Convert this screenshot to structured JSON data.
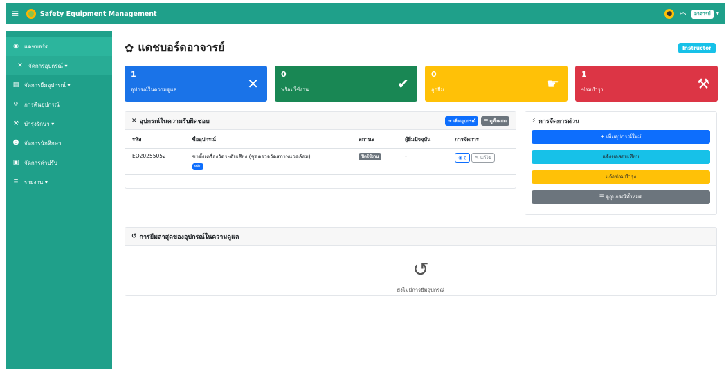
{
  "topbar": {
    "brand": "Safety Equipment Management",
    "user": "test",
    "role": "อาจารย์"
  },
  "sidebar": {
    "items": [
      {
        "label": "แดชบอร์ด",
        "icon": "palette-icon"
      },
      {
        "label": "จัดการอุปกรณ์ ▾",
        "icon": "tools-icon"
      },
      {
        "label": "จัดการยืมอุปกรณ์ ▾",
        "icon": "clipboard-icon"
      },
      {
        "label": "การคืนอุปกรณ์",
        "icon": "undo-icon"
      },
      {
        "label": "บำรุงรักษา ▾",
        "icon": "wrench-icon"
      },
      {
        "label": "จัดการนักศึกษา",
        "icon": "users-icon"
      },
      {
        "label": "จัดการค่าปรับ",
        "icon": "money-icon"
      },
      {
        "label": "รายงาน ▾",
        "icon": "list-icon"
      }
    ]
  },
  "page": {
    "title": "แดชบอร์ดอาจารย์",
    "badge": "Instructor"
  },
  "stats": [
    {
      "value": "1",
      "label": "อุปกรณ์ในความดูแล",
      "color": "#1a73e8",
      "icon": "tools-icon"
    },
    {
      "value": "0",
      "label": "พร้อมใช้งาน",
      "color": "#198754",
      "icon": "check-circle-icon"
    },
    {
      "value": "0",
      "label": "ถูกยืม",
      "color": "#ffc107",
      "icon": "hand-icon"
    },
    {
      "value": "1",
      "label": "ซ่อมบำรุง",
      "color": "#dc3545",
      "icon": "wrench-icon"
    }
  ],
  "equipment": {
    "title": "อุปกรณ์ในความรับผิดชอบ",
    "add_label": "+ เพิ่มอุปกรณ์",
    "view_all_label": "☰ ดูทั้งหมด",
    "columns": [
      "รหัส",
      "ชื่ออุปกรณ์",
      "สถานะ",
      "ผู้ยืมปัจจุบัน",
      "การจัดการ"
    ],
    "rows": [
      {
        "code": "EQ20255052",
        "name": "ขาตั้งเครื่องวัดระดับเสียง (ชุดตรวจวัดสภาพแวดล้อม)",
        "tag": "หลัก",
        "status": "ปิดใช้งาน",
        "borrower": "-",
        "view": "ดู",
        "edit": "แก้ไข"
      }
    ]
  },
  "quick": {
    "title": "การจัดการด่วน",
    "buttons": [
      {
        "label": "+ เพิ่มอุปกรณ์ใหม่",
        "bg": "#0d6efd",
        "fg": "#ffffff"
      },
      {
        "label": "แจ้งขอสอบเทียบ",
        "bg": "#17c1e8",
        "fg": "#212529"
      },
      {
        "label": "แจ้งซ่อมบำรุง",
        "bg": "#ffc107",
        "fg": "#212529"
      },
      {
        "label": "☰ ดูอุปกรณ์ทั้งหมด",
        "bg": "#6c757d",
        "fg": "#ffffff"
      }
    ]
  },
  "recent": {
    "title": "การยืมล่าสุดของอุปกรณ์ในความดูแล",
    "empty": "ยังไม่มีการยืมอุปกรณ์"
  }
}
